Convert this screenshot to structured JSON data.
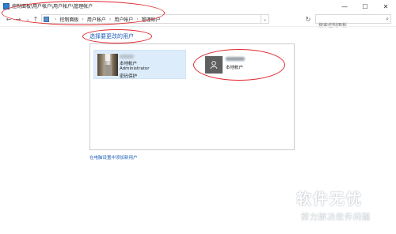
{
  "window": {
    "title": "控制面板\\用户帐户\\用户帐户\\管理帐户",
    "minimize_glyph": "—",
    "maximize_glyph": "☐",
    "close_glyph": "✕"
  },
  "nav": {
    "back_glyph": "←",
    "forward_glyph": "→",
    "recent_glyph": "⌄",
    "up_glyph": "↑",
    "breadcrumb": [
      "控制面板",
      "用户帐户",
      "用户帐户",
      "管理帐户"
    ],
    "separator": "›",
    "dropdown_glyph": "⌄",
    "refresh_glyph": "↻",
    "search_placeholder": "搜索控制面板",
    "search_glyph": "⌕"
  },
  "main": {
    "heading": "选择要更改的用户",
    "accounts": [
      {
        "lines": [
          "本地帐户",
          "Administrator",
          "密码保护"
        ],
        "selected": true
      },
      {
        "lines": [
          "本地帐户"
        ],
        "selected": false
      }
    ],
    "add_user_link": "在电脑设置中添加新用户"
  },
  "watermark": {
    "main": "软件无忧",
    "sub": "努力解决软件问题"
  },
  "colors": {
    "link": "#1e5eb8",
    "selected_tile": "#dcecfb",
    "annotation": "#e0282f"
  }
}
